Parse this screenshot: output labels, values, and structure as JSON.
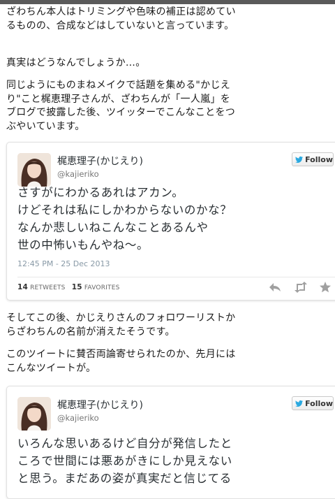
{
  "paragraphs": [
    "ざわちん本人はトリミングや色味の補正は認めているものの、合成などはしていないと言っています。",
    "真実はどうなんでしょうか…。",
    "同じようにものまねメイクで話題を集める\"かじえり\"こと梶恵理子さんが、ざわちんが「一人嵐」をブログで披露した後、ツイッターでこんなことをつぶやいています。",
    "そしてこの後、かじえりさんのフォロワーリストからざわちんの名前が消えたそうです。",
    "このツイートに賛否両論寄せられたのか、先月にはこんなツイートが。"
  ],
  "tweet1": {
    "name": "梶恵理子(かじえり)",
    "handle": "@kajieriko",
    "follow_label": "Follow",
    "lines": [
      "さすがにわかるあれはアカン。",
      "けどそれは私にしかわからないのかな？",
      "なんか悲しいねこんなことあるんや",
      "世の中怖いもんやね〜。"
    ],
    "timestamp": "12:45 PM - 25 Dec 2013",
    "retweets": "14",
    "retweets_label": "RETWEETS",
    "favorites": "15",
    "favorites_label": "FAVORITES"
  },
  "tweet2": {
    "name": "梶恵理子(かじえり)",
    "handle": "@kajieriko",
    "follow_label": "Follow",
    "lines": [
      "いろんな思いあるけど自分が発信したと",
      "ころで世間には悪あがきにしか見えない",
      "と思う。まだあの姿が真実だと信じてる"
    ]
  },
  "colors": {
    "twitter_blue": "#2aa9e0",
    "text": "#292f33",
    "meta": "#8899a6"
  },
  "icons": [
    "twitter-bird-icon",
    "reply-icon",
    "retweet-icon",
    "favorite-icon"
  ]
}
